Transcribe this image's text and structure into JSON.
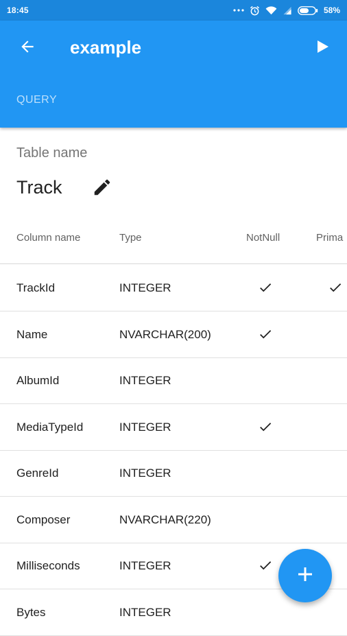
{
  "status_bar": {
    "time": "18:45",
    "battery": "58%"
  },
  "app_bar": {
    "title": "example",
    "tab": "QUERY"
  },
  "table": {
    "label": "Table name",
    "name": "Track"
  },
  "columns_header": {
    "name": "Column name",
    "type": "Type",
    "notnull": "NotNull",
    "primary": "Prima"
  },
  "rows": [
    {
      "name": "TrackId",
      "type": "INTEGER",
      "notnull": true,
      "primary": true
    },
    {
      "name": "Name",
      "type": "NVARCHAR(200)",
      "notnull": true,
      "primary": false
    },
    {
      "name": "AlbumId",
      "type": "INTEGER",
      "notnull": false,
      "primary": false
    },
    {
      "name": "MediaTypeId",
      "type": "INTEGER",
      "notnull": true,
      "primary": false
    },
    {
      "name": "GenreId",
      "type": "INTEGER",
      "notnull": false,
      "primary": false
    },
    {
      "name": "Composer",
      "type": "NVARCHAR(220)",
      "notnull": false,
      "primary": false
    },
    {
      "name": "Milliseconds",
      "type": "INTEGER",
      "notnull": true,
      "primary": false
    },
    {
      "name": "Bytes",
      "type": "INTEGER",
      "notnull": false,
      "primary": false
    }
  ],
  "colors": {
    "primary": "#2196f3",
    "status_bar": "#1b86dc"
  },
  "icons": [
    "dots-icon",
    "alarm-icon",
    "wifi-icon",
    "signal-icon",
    "battery-icon",
    "back-arrow-icon",
    "play-icon",
    "edit-pencil-icon",
    "check-icon",
    "add-icon"
  ]
}
